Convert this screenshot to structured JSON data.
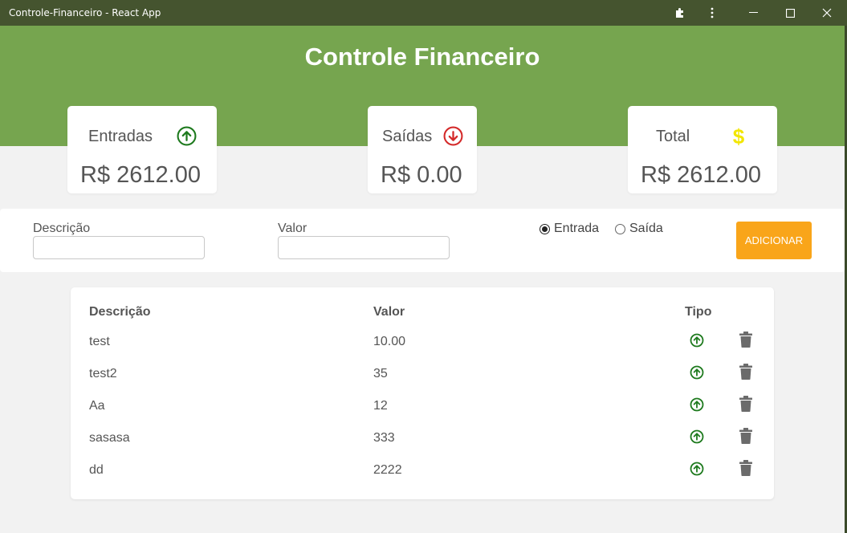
{
  "window": {
    "title": "Controle-Financeiro - React App"
  },
  "header": {
    "title": "Controle Financeiro"
  },
  "summary": {
    "income": {
      "label": "Entradas",
      "value": "R$ 2612.00",
      "icon": "arrow-up-circle-icon",
      "color": "#1e7a1e"
    },
    "expense": {
      "label": "Saídas",
      "value": "R$ 0.00",
      "icon": "arrow-down-circle-icon",
      "color": "#d42a2a"
    },
    "total": {
      "label": "Total",
      "value": "R$ 2612.00",
      "icon": "dollar-icon",
      "color": "#f2e600"
    }
  },
  "form": {
    "description_label": "Descrição",
    "description_value": "",
    "value_label": "Valor",
    "value_value": "",
    "radio_income_label": "Entrada",
    "radio_expense_label": "Saída",
    "selected_type": "Entrada",
    "add_button": "ADICIONAR"
  },
  "table": {
    "headers": {
      "description": "Descrição",
      "value": "Valor",
      "type": "Tipo"
    },
    "rows": [
      {
        "description": "test",
        "value": "10.00",
        "type": "income"
      },
      {
        "description": "test2",
        "value": "35",
        "type": "income"
      },
      {
        "description": "Aa",
        "value": "12",
        "type": "income"
      },
      {
        "description": "sasasa",
        "value": "333",
        "type": "income"
      },
      {
        "description": "dd",
        "value": "2222",
        "type": "income"
      }
    ]
  },
  "colors": {
    "titlebar": "#45542f",
    "header": "#76a54f",
    "accent_button": "#f9a51a",
    "income": "#1e7a1e",
    "trash": "#6b6b6b"
  }
}
